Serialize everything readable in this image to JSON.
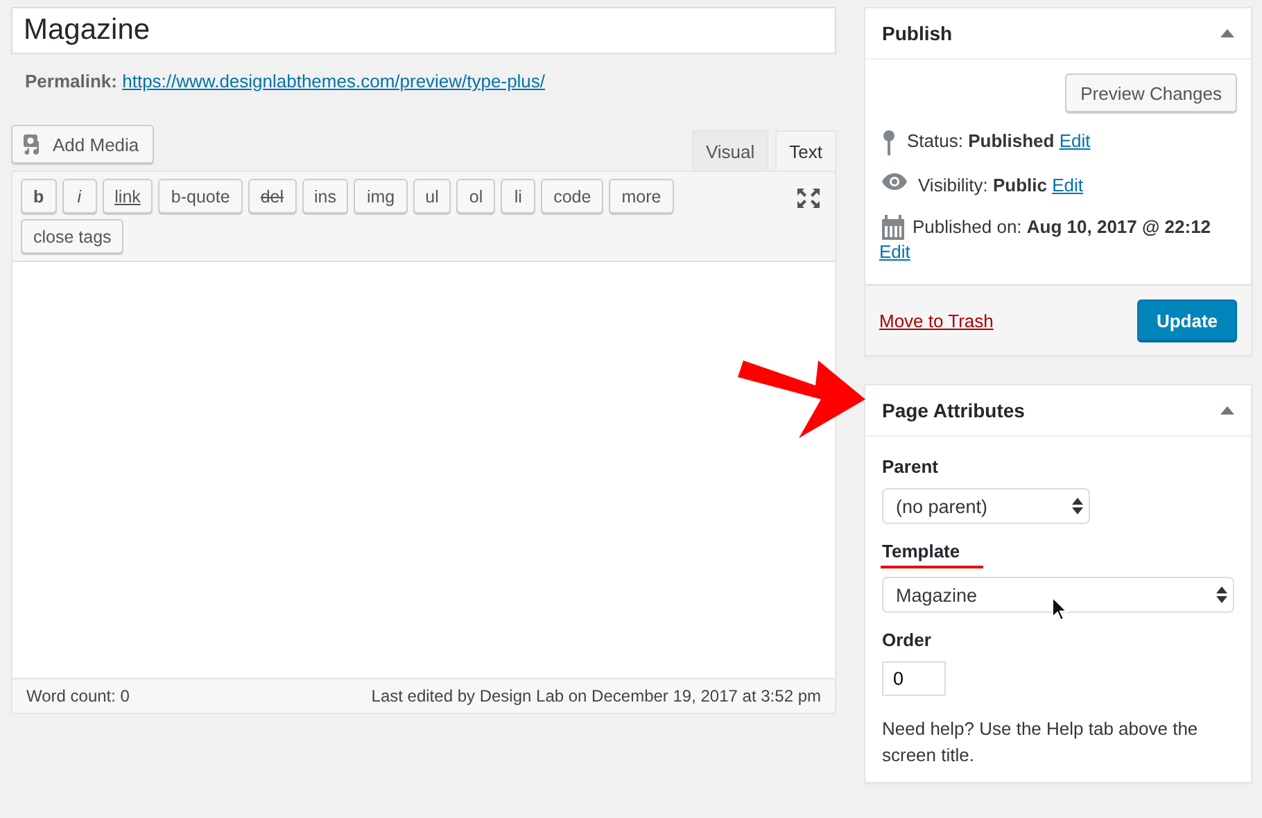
{
  "title_field": {
    "value": "Magazine"
  },
  "permalink": {
    "label": "Permalink:",
    "url": "https://www.designlabthemes.com/preview/type-plus/"
  },
  "editor": {
    "add_media": "Add Media",
    "tabs": [
      {
        "label": "Visual",
        "selected": false
      },
      {
        "label": "Text",
        "selected": true
      }
    ],
    "quicktags": [
      {
        "label": "b",
        "kind": "bold"
      },
      {
        "label": "i",
        "kind": "italic"
      },
      {
        "label": "link",
        "kind": "underline"
      },
      {
        "label": "b-quote",
        "kind": "plain"
      },
      {
        "label": "del",
        "kind": "strike"
      },
      {
        "label": "ins",
        "kind": "plain"
      },
      {
        "label": "img",
        "kind": "plain"
      },
      {
        "label": "ul",
        "kind": "plain"
      },
      {
        "label": "ol",
        "kind": "plain"
      },
      {
        "label": "li",
        "kind": "plain"
      },
      {
        "label": "code",
        "kind": "plain"
      },
      {
        "label": "more",
        "kind": "plain"
      },
      {
        "label": "close tags",
        "kind": "plain"
      }
    ],
    "word_count": "Word count: 0",
    "last_edited": "Last edited by Design Lab on December 19, 2017 at 3:52 pm"
  },
  "publish": {
    "title": "Publish",
    "preview_button": "Preview Changes",
    "items": [
      {
        "kind": "pin",
        "text": "Status: **Published**",
        "edit": "Edit"
      },
      {
        "kind": "eye",
        "text": "Visibility: **Public**",
        "edit": "Edit"
      },
      {
        "kind": "calendar",
        "text": "Published on: **Aug 10, 2017 @ 22:12**",
        "edit": "Edit"
      }
    ],
    "trash": "Move to Trash",
    "update": "Update"
  },
  "page_attributes": {
    "title": "Page Attributes",
    "parent": {
      "label": "Parent",
      "value": "(no parent)"
    },
    "template": {
      "label": "Template",
      "value": "Magazine",
      "underlined": true
    },
    "order": {
      "label": "Order",
      "value": "0"
    },
    "help": "Need help? Use the Help tab above the screen title."
  }
}
